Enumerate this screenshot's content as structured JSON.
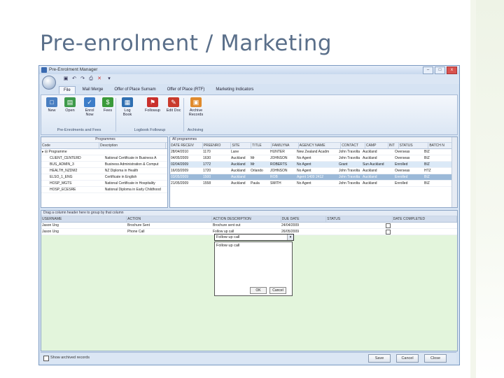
{
  "slide": {
    "title": "Pre-enrolment / Marketing"
  },
  "window": {
    "title": "Pre-Enrolment Manager",
    "min_icon": "minimize-icon",
    "max_icon": "maximize-icon",
    "close_label": "x"
  },
  "ribbon": {
    "tabs": [
      "File",
      "Mail Merge",
      "Offer of Place Surnam",
      "Offer of Place (RTF)",
      "Marketing Indicators"
    ],
    "buttons": [
      {
        "label": "New",
        "color": "#4a7fc1"
      },
      {
        "label": "Open",
        "color": "#3d9a4a"
      },
      {
        "label": "Enrol Now",
        "color": "#3d7dc8"
      },
      {
        "label": "Fees",
        "color": "#3a9a3a"
      },
      {
        "label": "Log Book",
        "color": "#2f6fb1"
      },
      {
        "label": "Followup",
        "color": "#c9302c"
      },
      {
        "label": "Edit Doc",
        "color": "#c93a2c"
      },
      {
        "label": "Archive Records",
        "color": "#e08a2c"
      }
    ],
    "groups": [
      "Pre-Enrolments and Fees",
      "Logbook Followup",
      "Archiving"
    ]
  },
  "tree": {
    "columns": [
      "Code",
      "Description"
    ],
    "group_header": "Programmes",
    "root": "Programme",
    "rows": [
      [
        "CLIENT_CENTERD",
        "National Certificate in Business A"
      ],
      [
        "BUS_ADMIN_3",
        "Business Administration & Comput"
      ],
      [
        "HEALTH_NZDM2",
        "NZ Diploma in Health"
      ],
      [
        "ELSO_1_ENG",
        "Certificate in English"
      ],
      [
        "HOSP_MGTS",
        "National Certificate in Hospitality"
      ],
      [
        "HOSP_ECESRE",
        "National Diploma in Early Childhood"
      ]
    ]
  },
  "grid": {
    "caption": "All programmes",
    "columns": [
      "DATE RECEIV",
      "PREENRO",
      "SITE",
      "TITLE",
      "FAMILYNA",
      "AGENCY NAME",
      "CONTACT",
      "CAMP",
      "INT",
      "STATUS",
      "BATCH N"
    ],
    "rows": [
      [
        "28/04/2010",
        "1170",
        "Lane",
        "",
        "HUNTER",
        "New Zealand Acadm",
        "John Travolta",
        "Auckland",
        "",
        "Overseas",
        "BIZ"
      ],
      [
        "04/05/2009",
        "1630",
        "Auckland",
        "Mr",
        "JOHNSON",
        "No Agent",
        "John Travolta",
        "Auckland",
        "",
        "Overseas",
        "BIZ"
      ],
      [
        "02/04/2009",
        "1772",
        "Auckland",
        "Mr",
        "ROBERTS",
        "No Agent",
        "Grant",
        "Sun Auckland",
        "",
        "Enrolled",
        "BIZ"
      ],
      [
        "16/03/2009",
        "1720",
        "Auckland",
        "Orlando",
        "JOHNSON",
        "No Agent",
        "John Travolta",
        "Auckland",
        "",
        "Overseas",
        "HTZ"
      ],
      [
        "03/05/2009",
        "1500",
        "Auckland",
        "",
        "ROB",
        "Agent 1400 2412",
        "John Travolta",
        "Auckland",
        "",
        "Enrolled",
        "BIZ"
      ],
      [
        "21/05/2009",
        "1558",
        "Auckland",
        "Paula",
        "SMITH",
        "No Agent",
        "John Travolta",
        "Auckland",
        "",
        "Enrolled",
        "BIZ"
      ]
    ]
  },
  "followup": {
    "caption": "Drag a column header here to group by that column",
    "columns": [
      "USERNAME",
      "ACTION",
      "ACTION DESCRIPTION",
      "DUE DATE",
      "STATUS",
      "DATE COMPLETED"
    ],
    "rows": [
      [
        "Jason Ung",
        "Brochure Sent",
        "Brochure sent out",
        "24/04/2009",
        ""
      ],
      [
        "Jason Ung",
        "Phone Call",
        "Follow up call",
        "26/05/2009",
        ""
      ]
    ],
    "combo_value": "Follow up call",
    "popup_text": "Follow up call",
    "ok_label": "OK",
    "cancel_label": "Cancel"
  },
  "status": {
    "checkbox_label": "Show archived records",
    "save_label": "Save",
    "cancel_label": "Cancel",
    "close_label": "Close"
  }
}
